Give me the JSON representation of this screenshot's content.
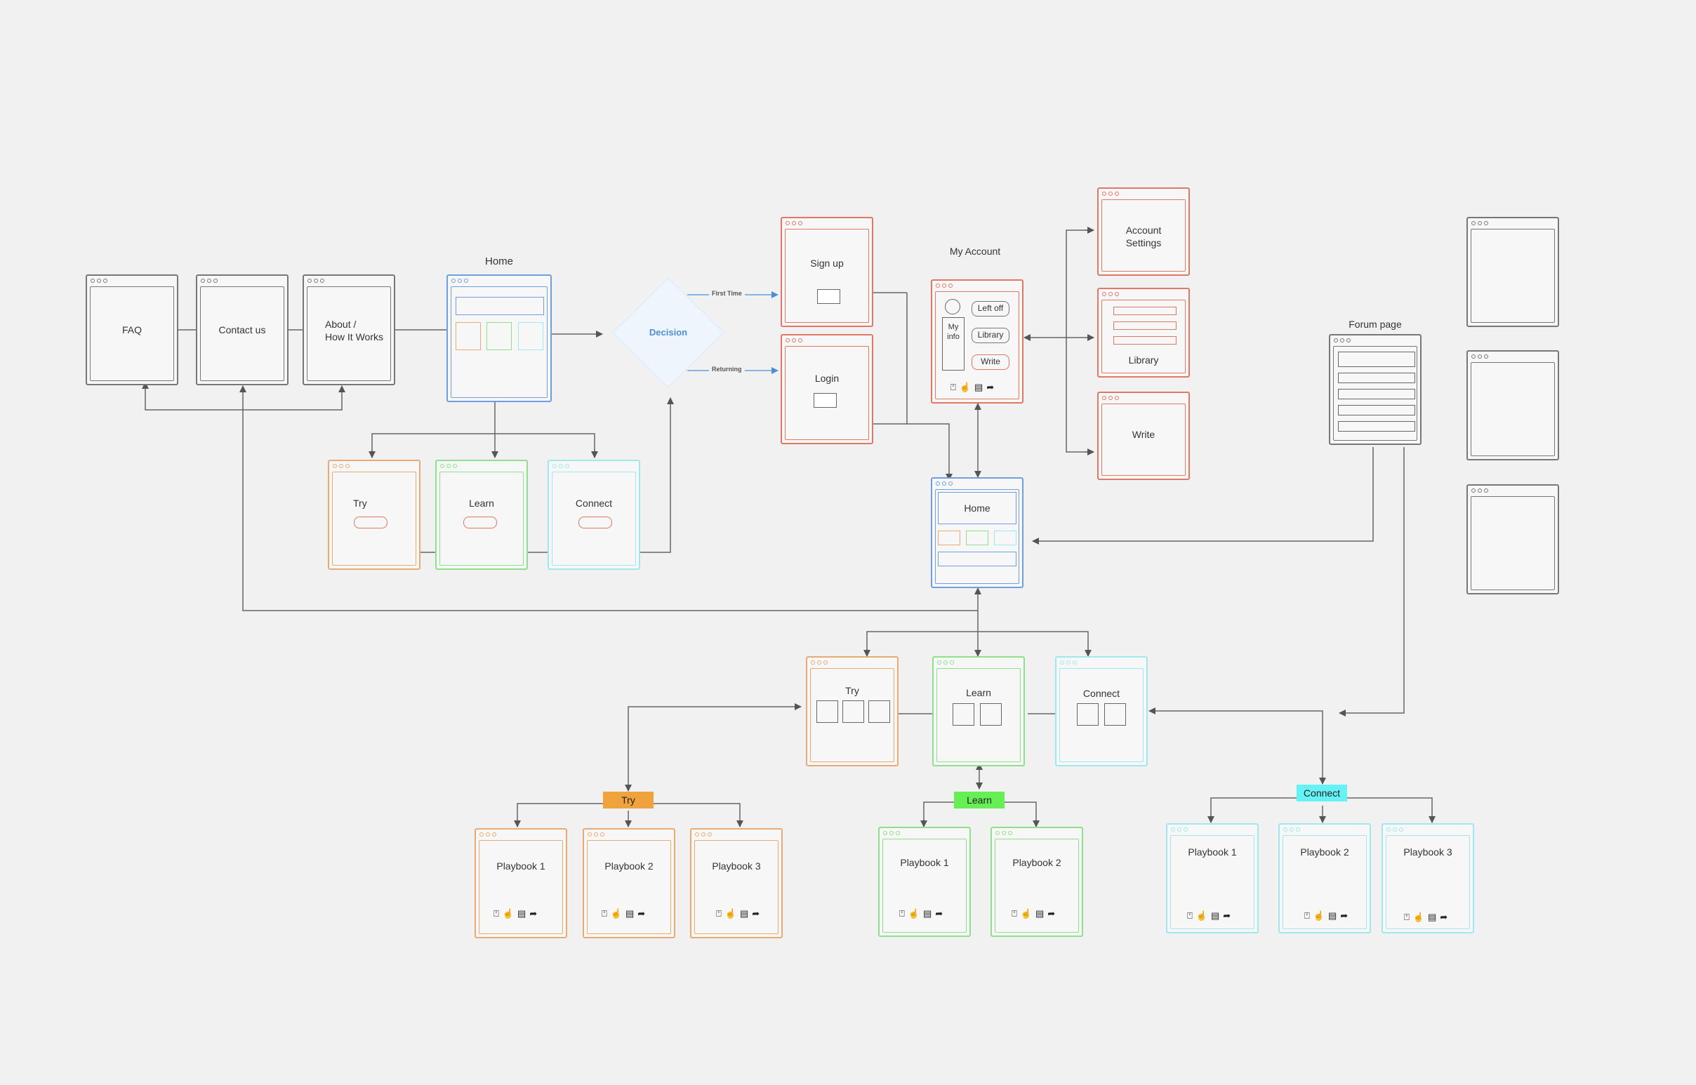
{
  "nodes": {
    "faq": "FAQ",
    "contact": "Contact us",
    "about": "About /\nHow It Works",
    "home_title": "Home",
    "decision": "Decision",
    "first_time": "First Time",
    "returning": "Returning",
    "try_top": "Try",
    "learn_top": "Learn",
    "connect_top": "Connect",
    "signup": "Sign up",
    "login": "Login",
    "my_account_title": "My Account",
    "my_info": "My\ninfo",
    "left_off": "Left off",
    "library_btn": "Library",
    "write_btn": "Write",
    "account_settings": "Account\nSettings",
    "library": "Library",
    "write": "Write",
    "forum_title": "Forum page",
    "home2": "Home",
    "try_mid": "Try",
    "learn_mid": "Learn",
    "connect_mid": "Connect",
    "tag_try": "Try",
    "tag_learn": "Learn",
    "tag_connect": "Connect",
    "playbook_1": "Playbook 1",
    "playbook_2": "Playbook 2",
    "playbook_3": "Playbook 3"
  },
  "icons": [
    "bookmark-icon",
    "thumbs-up-icon",
    "comment-icon",
    "share-icon"
  ],
  "colors": {
    "gray": "#777777",
    "red": "#e07866",
    "blue": "#6f9fe0",
    "orange": "#eaaa73",
    "green": "#8ee08a",
    "cyan": "#9ee8ee",
    "tag_try": "#f0a23c",
    "tag_learn": "#66ee55",
    "tag_connect": "#66f2f5",
    "decision": "#4a90d9"
  }
}
